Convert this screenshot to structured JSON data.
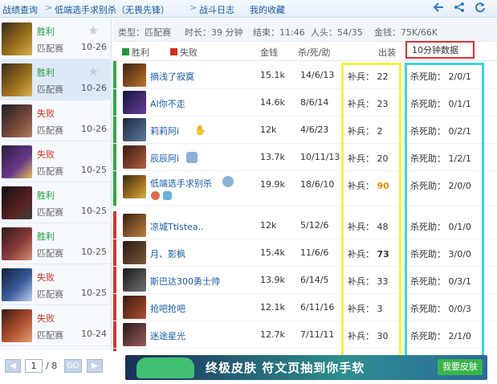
{
  "topbar": {
    "crumbs": [
      "战绩查询",
      "低端选手求别杀（无畏先锋）",
      "战斗日志",
      "我的收藏"
    ],
    "separators": [
      ">",
      ">"
    ],
    "icons": [
      "back-arrow-icon",
      "share-icon",
      "refresh-icon"
    ]
  },
  "sidebar": {
    "matches": [
      {
        "result": "胜利",
        "mode": "匹配赛",
        "date": "10-26",
        "color": "#1e9a3a"
      },
      {
        "result": "胜利",
        "mode": "匹配赛",
        "date": "10-26",
        "color": "#1e9a3a"
      },
      {
        "result": "失败",
        "mode": "匹配赛",
        "date": "10-26",
        "color": "#d0301f"
      },
      {
        "result": "失败",
        "mode": "匹配赛",
        "date": "10-25",
        "color": "#d0301f"
      },
      {
        "result": "胜利",
        "mode": "匹配赛",
        "date": "10-25",
        "color": "#1e9a3a"
      },
      {
        "result": "胜利",
        "mode": "匹配赛",
        "date": "10-25",
        "color": "#1e9a3a"
      },
      {
        "result": "失败",
        "mode": "匹配赛",
        "date": "10-25",
        "color": "#d0301f"
      },
      {
        "result": "失败",
        "mode": "匹配赛",
        "date": "10-24",
        "color": "#d0301f"
      }
    ],
    "pager": {
      "current": "1",
      "total": "/ 8",
      "go": "GO",
      "prev": "◀",
      "next": "▶"
    }
  },
  "info": {
    "type": "类型：匹配赛",
    "duration": "时长：39 分钟",
    "end": "结束：11:46",
    "kills": "人头：54/35",
    "gold": "金钱：75K/66K"
  },
  "header": {
    "win": "胜利",
    "lose": "失败",
    "gold": "金钱",
    "kda": "杀/死/助",
    "items": "出装",
    "tab": "10分钟数据",
    "win_color": "#1e9a3a",
    "lose_color": "#d0301f"
  },
  "players": [
    {
      "name": "摘浅了寂寞",
      "gold": "15.1k",
      "kda": "14/6/13",
      "cs_label": "补兵：",
      "cs": "22",
      "ka_label": "杀死助：",
      "ka": "2/0/1",
      "team": "win"
    },
    {
      "name": "AI你不走",
      "gold": "14.6k",
      "kda": "8/6/14",
      "cs_label": "补兵：",
      "cs": "23",
      "ka_label": "杀死助：",
      "ka": "0/1/1",
      "team": "win"
    },
    {
      "name": "莉莉阿i",
      "gold": "12k",
      "kda": "4/6/23",
      "cs_label": "补兵：",
      "cs": "2",
      "ka_label": "杀死助：",
      "ka": "0/2/1",
      "team": "win"
    },
    {
      "name": "辰辰阿i",
      "gold": "13.7k",
      "kda": "10/11/13",
      "cs_label": "补兵：",
      "cs": "20",
      "ka_label": "杀死助：",
      "ka": "1/2/1",
      "team": "win"
    },
    {
      "name": "低端选手求别杀",
      "gold": "19.9k",
      "kda": "18/6/10",
      "cs_label": "补兵：",
      "cs": "90",
      "ka_label": "杀死助：",
      "ka": "2/0/0",
      "team": "win"
    },
    {
      "name": "凉城Ttistea..",
      "gold": "12k",
      "kda": "5/12/6",
      "cs_label": "补兵：",
      "cs": "48",
      "ka_label": "杀死助：",
      "ka": "0/1/0",
      "team": "lose"
    },
    {
      "name": "月、影枫",
      "gold": "15.4k",
      "kda": "11/6/6",
      "cs_label": "补兵：",
      "cs": "73",
      "ka_label": "杀死助：",
      "ka": "3/0/0",
      "team": "lose"
    },
    {
      "name": "斯巴达300勇士帅",
      "gold": "13.9k",
      "kda": "6/14/5",
      "cs_label": "补兵：",
      "cs": "33",
      "ka_label": "杀死助：",
      "ka": "0/3/1",
      "team": "lose"
    },
    {
      "name": "抢吧抢吧",
      "gold": "12.1k",
      "kda": "6/11/16",
      "cs_label": "补兵：",
      "cs": "3",
      "ka_label": "杀死助：",
      "ka": "0/0/3",
      "team": "lose"
    },
    {
      "name": "迷途星光",
      "gold": "12.7k",
      "kda": "7/11/11",
      "cs_label": "补兵：",
      "cs": "30",
      "ka_label": "杀死助：",
      "ka": "2/1/0",
      "team": "lose"
    }
  ],
  "banner": {
    "text": "终极皮肤 符文页抽到你手软",
    "button": "我要皮肤"
  }
}
